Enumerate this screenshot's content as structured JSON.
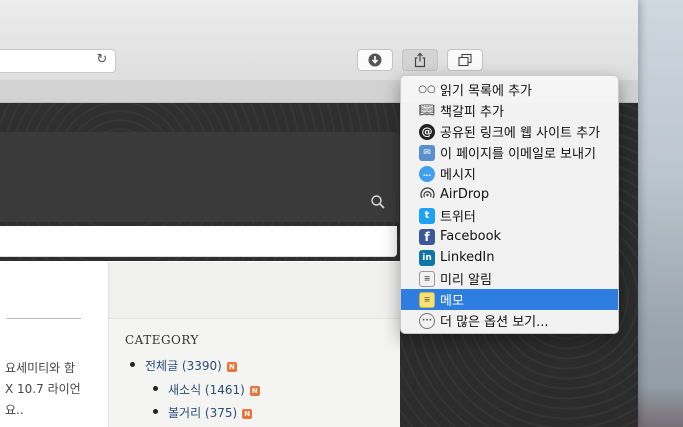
{
  "toolbar": {
    "download_icon": "download-icon",
    "share_icon": "share-icon",
    "tabs_icon": "tabs-overview-icon",
    "reload_icon": "reload-icon"
  },
  "content": {
    "left_lines": [
      "요세미티와 함",
      "X 10.7 라이언",
      "요.."
    ],
    "category_title": "CATEGORY",
    "categories": [
      {
        "label": "전체글 (3390)",
        "badge": "N"
      },
      {
        "label": "새소식 (1461)",
        "badge": "N"
      },
      {
        "label": "볼거리 (375)",
        "badge": "N"
      }
    ]
  },
  "share_menu": {
    "items": [
      {
        "label": "읽기 목록에 추가",
        "icon": "reading-list-icon",
        "color": "#333333"
      },
      {
        "label": "책갈피 추가",
        "icon": "bookmark-book-icon",
        "color": "#333333"
      },
      {
        "label": "공유된 링크에 웹 사이트 추가",
        "icon": "shared-links-icon",
        "color": "#222222"
      },
      {
        "label": "이 페이지를 이메일로 보내기",
        "icon": "mail-icon",
        "color": "#5a8fd0"
      },
      {
        "label": "메시지",
        "icon": "messages-icon",
        "color": "#3fa0f0"
      },
      {
        "label": "AirDrop",
        "icon": "airdrop-icon",
        "color": "#444444"
      },
      {
        "label": "트위터",
        "icon": "twitter-icon",
        "color": "#1da1f2"
      },
      {
        "label": "Facebook",
        "icon": "facebook-icon",
        "color": "#3b5998"
      },
      {
        "label": "LinkedIn",
        "icon": "linkedin-icon",
        "color": "#0e76a8"
      },
      {
        "label": "미리 알림",
        "icon": "reminders-icon",
        "color": "#f1f1f1"
      },
      {
        "label": "메모",
        "icon": "notes-icon",
        "color": "#f5e27a",
        "selected": true
      },
      {
        "label": "더 많은 옵션 보기...",
        "icon": "more-options-icon",
        "color": "#888888"
      }
    ]
  }
}
